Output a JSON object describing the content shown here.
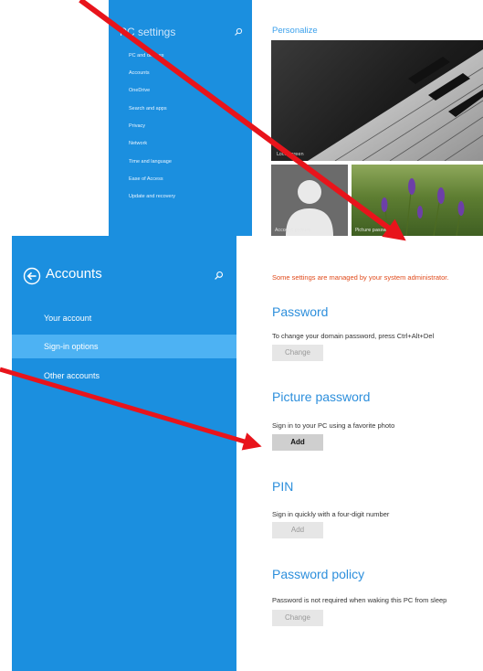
{
  "pc_settings": {
    "title": "PC settings",
    "items": [
      "PC and devices",
      "Accounts",
      "OneDrive",
      "Search and apps",
      "Privacy",
      "Network",
      "Time and language",
      "Ease of Access",
      "Update and recovery"
    ]
  },
  "personalize": {
    "heading": "Personalize",
    "lock_screen_label": "Lock screen",
    "account_picture_label": "Account picture",
    "picture_password_label": "Picture password"
  },
  "accounts": {
    "title": "Accounts",
    "items": [
      {
        "label": "Your account",
        "selected": false
      },
      {
        "label": "Sign-in options",
        "selected": true
      },
      {
        "label": "Other accounts",
        "selected": false
      }
    ]
  },
  "content": {
    "admin_notice": "Some settings are managed by your system administrator.",
    "password": {
      "title": "Password",
      "desc": "To change your domain password, press Ctrl+Alt+Del",
      "button": "Change"
    },
    "picture_password": {
      "title": "Picture password",
      "desc": "Sign in to your PC using a favorite photo",
      "button": "Add"
    },
    "pin": {
      "title": "PIN",
      "desc": "Sign in quickly with a four-digit number",
      "button": "Add"
    },
    "password_policy": {
      "title": "Password policy",
      "desc": "Password is not required when waking this PC from sleep",
      "button": "Change"
    }
  },
  "colors": {
    "panel": "#1b8fdf",
    "selected": "#4db2f3",
    "accent": "#2d8fdc",
    "warning": "#e04a1b",
    "annotation": "#e8141b"
  },
  "icons": [
    "search-icon",
    "back-arrow-icon",
    "person-icon"
  ]
}
